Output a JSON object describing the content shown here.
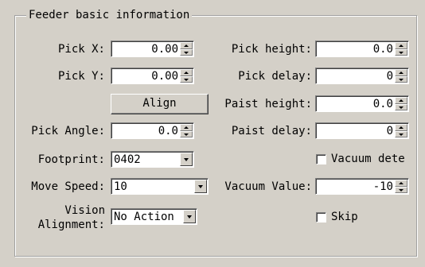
{
  "group": {
    "title": "Feeder basic information"
  },
  "fields": {
    "pick_x": {
      "label": "Pick X:",
      "value": "0.00"
    },
    "pick_y": {
      "label": "Pick Y:",
      "value": "0.00"
    },
    "pick_angle": {
      "label": "Pick Angle:",
      "value": "0.0"
    },
    "pick_height": {
      "label": "Pick height:",
      "value": "0.0"
    },
    "pick_delay": {
      "label": "Pick delay:",
      "value": "0"
    },
    "paist_height": {
      "label": "Paist height:",
      "value": "0.0"
    },
    "paist_delay": {
      "label": "Paist delay:",
      "value": "0"
    },
    "vacuum_value": {
      "label": "Vacuum Value:",
      "value": "-10"
    },
    "footprint": {
      "label": "Footprint:",
      "value": "0402"
    },
    "move_speed": {
      "label": "Move Speed:",
      "value": "10"
    },
    "vision_alignment": {
      "label_line1": "Vision",
      "label_line2": "Alignment:",
      "value": "No Action"
    }
  },
  "buttons": {
    "align": "Align"
  },
  "checks": {
    "vacuum_detect": {
      "label": "Vacuum dete",
      "checked": false
    },
    "skip": {
      "label": "Skip",
      "checked": false
    }
  }
}
